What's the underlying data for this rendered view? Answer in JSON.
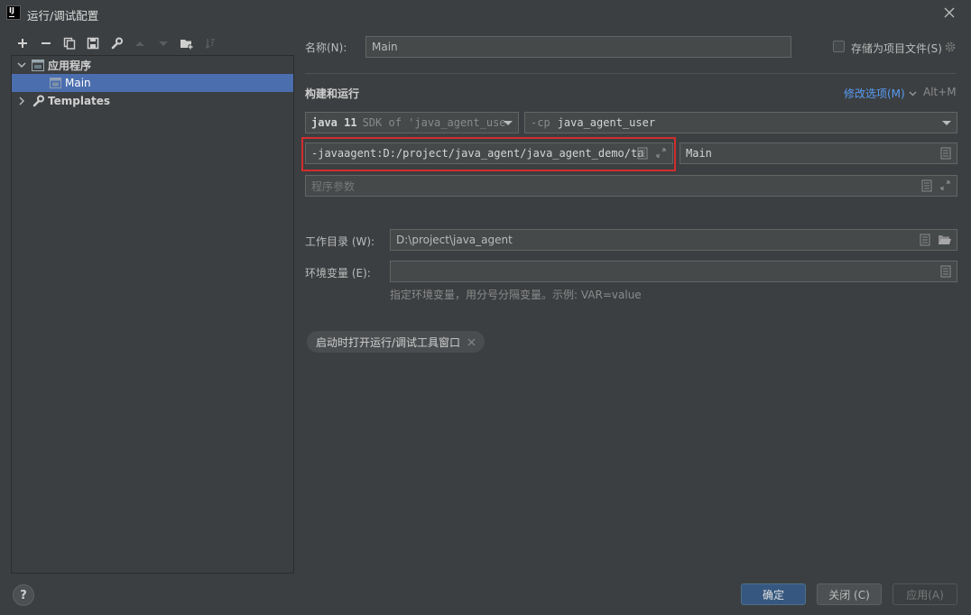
{
  "window": {
    "title": "运行/调试配置",
    "logo_text": "IJ"
  },
  "toolbar": {
    "icons": [
      "add-icon",
      "remove-icon",
      "copy-icon",
      "save-icon",
      "wrench-icon",
      "arrow-up-icon",
      "arrow-down-icon",
      "new-folder-icon",
      "sort-icon"
    ]
  },
  "tree": {
    "app_group": "应用程序",
    "main_item": "Main",
    "templates": "Templates"
  },
  "form": {
    "name_label": "名称(N):",
    "name_value": "Main",
    "store_label": "存储为项目文件(S)",
    "section_title": "构建和运行",
    "modify_options": "修改选项(M)",
    "modify_shortcut": "Alt+M",
    "jdk_keyword": "java 11",
    "jdk_detail": "SDK of 'java_agent_use",
    "cp_flag": "-cp",
    "cp_value": "java_agent_user",
    "vm_options": "-javaagent:D:/project/java_agent/java_agent_demo/ta",
    "main_class": "Main",
    "program_args_placeholder": "程序参数",
    "workdir_label": "工作目录 (W):",
    "workdir_value": "D:\\project\\java_agent",
    "env_label": "环境变量 (E):",
    "env_value": "",
    "env_hint": "指定环境变量，用分号分隔变量。示例: VAR=value",
    "chip_label": "启动时打开运行/调试工具窗口"
  },
  "footer": {
    "help": "?",
    "ok": "确定",
    "close": "关闭 (C)",
    "apply": "应用(A)"
  },
  "colors": {
    "background": "#3c3f41",
    "selection": "#4b6eaf",
    "primary_button": "#365880",
    "highlight_border": "#d12d2d",
    "link": "#589df6"
  }
}
